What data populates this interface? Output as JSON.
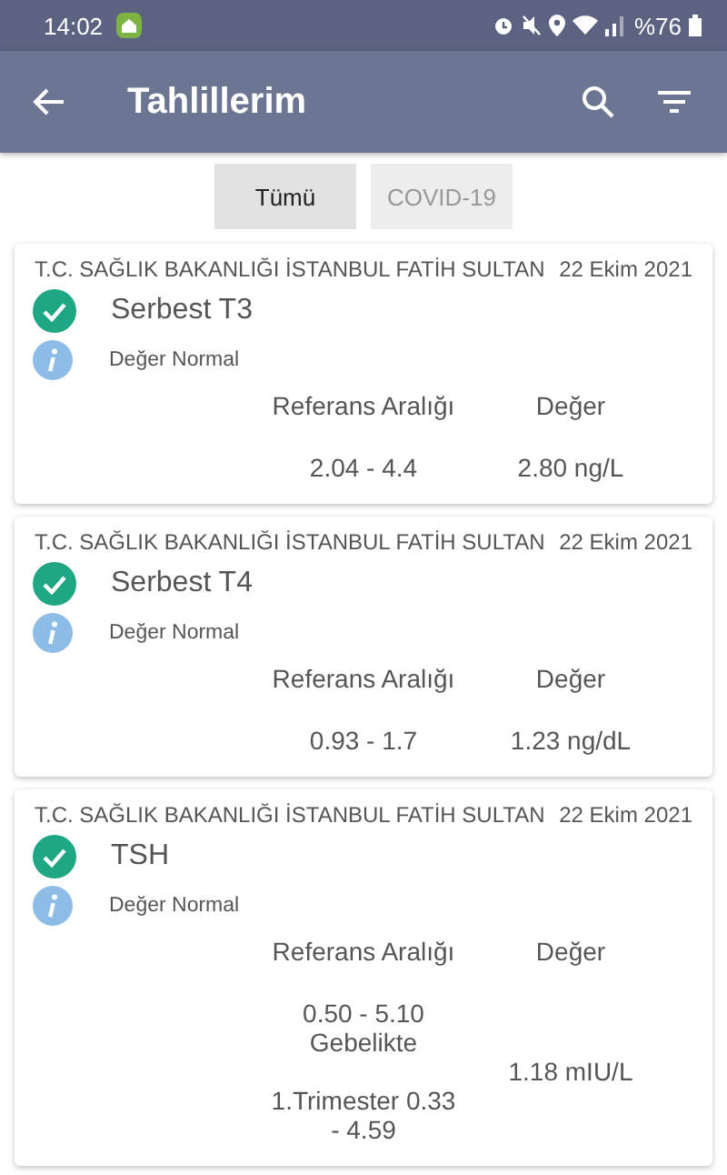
{
  "status_bar": {
    "time": "14:02",
    "battery": "%76"
  },
  "app_bar": {
    "title": "Tahlillerim"
  },
  "filters": [
    {
      "label": "Tümü",
      "selected": true
    },
    {
      "label": "COVID-19",
      "selected": false
    }
  ],
  "results": [
    {
      "institution": "T.C. SAĞLIK BAKANLIĞI İSTANBUL FATİH SULTAN",
      "date": "22 Ekim 2021",
      "test": "Serbest T3",
      "status": "Değer Normal",
      "normal": true,
      "reference_header": "Referans Aralığı",
      "value_header": "Değer",
      "reference": "2.04 - 4.4",
      "value": "2.80 ng/L"
    },
    {
      "institution": "T.C. SAĞLIK BAKANLIĞI İSTANBUL FATİH SULTAN",
      "date": "22 Ekim 2021",
      "test": "Serbest T4",
      "status": "Değer Normal",
      "normal": true,
      "reference_header": "Referans Aralığı",
      "value_header": "Değer",
      "reference": "0.93 - 1.7",
      "value": "1.23 ng/dL"
    },
    {
      "institution": "T.C. SAĞLIK BAKANLIĞI İSTANBUL FATİH SULTAN",
      "date": "22 Ekim 2021",
      "test": "TSH",
      "status": "Değer Normal",
      "normal": true,
      "reference_header": "Referans Aralığı",
      "value_header": "Değer",
      "reference": "0.50 - 5.10\nGebelikte\n\n1.Trimester   0.33\n- 4.59",
      "value": "1.18 mIU/L"
    }
  ]
}
